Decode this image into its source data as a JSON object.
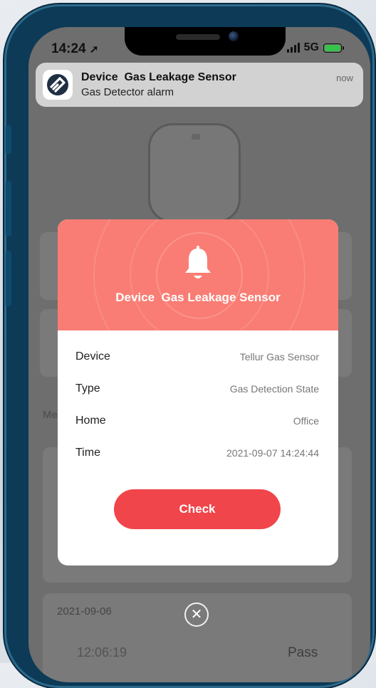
{
  "status_bar": {
    "time": "14:24",
    "network": "5G"
  },
  "notification": {
    "title": "Device  Gas Leakage Sensor",
    "body": "Gas Detector alarm",
    "time": "now",
    "app_icon": "tellur-logo-icon"
  },
  "background": {
    "section_label_fragment": "Me",
    "log_date": "2021-09-06",
    "log_time": "12:06:19",
    "log_result": "Pass"
  },
  "dialog": {
    "header_icon": "bell-icon",
    "title": "Device  Gas Leakage Sensor",
    "rows": [
      {
        "label": "Device",
        "value": "Tellur Gas Sensor"
      },
      {
        "label": "Type",
        "value": "Gas Detection State"
      },
      {
        "label": "Home",
        "value": "Office"
      },
      {
        "label": "Time",
        "value": "2021-09-07 14:24:44"
      }
    ],
    "check_label": "Check",
    "close_icon": "close-icon"
  },
  "colors": {
    "header": "#f97d74",
    "button": "#f0454a",
    "frame": "#0d3a57",
    "battery": "#38c24a"
  }
}
